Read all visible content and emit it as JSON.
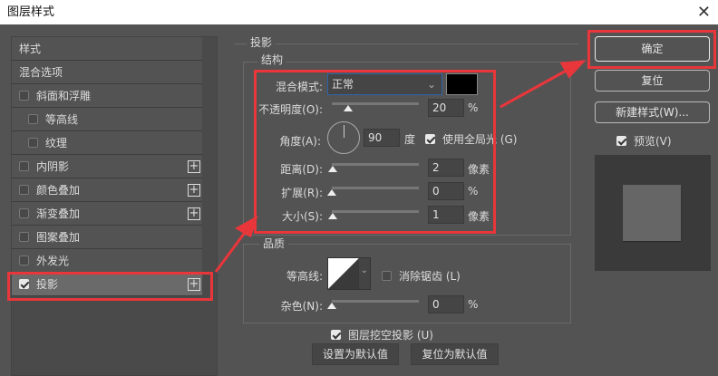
{
  "window": {
    "title": "图层样式",
    "close": "✕"
  },
  "sidebar": {
    "items": [
      {
        "label": "样式"
      },
      {
        "label": "混合选项"
      },
      {
        "label": "斜面和浮雕",
        "checked": false
      },
      {
        "label": "等高线",
        "checked": false
      },
      {
        "label": "纹理",
        "checked": false
      },
      {
        "label": "内阴影",
        "checked": false
      },
      {
        "label": "颜色叠加",
        "checked": false
      },
      {
        "label": "渐变叠加",
        "checked": false
      },
      {
        "label": "图案叠加",
        "checked": false
      },
      {
        "label": "外发光",
        "checked": false
      },
      {
        "label": "投影",
        "checked": true
      }
    ],
    "plus": "+"
  },
  "panel": {
    "title": "投影",
    "structure": {
      "title": "结构",
      "blend_mode_label": "混合模式:",
      "blend_mode": "正常",
      "shadow_color": "#000000",
      "opacity_label": "不透明度(O):",
      "opacity": "20",
      "opacity_unit": "%",
      "angle_label": "角度(A):",
      "angle": "90",
      "angle_unit": "度",
      "global_light_label": "使用全局光 (G)",
      "global_light": true,
      "distance_label": "距离(D):",
      "distance": "2",
      "distance_unit": "像素",
      "spread_label": "扩展(R):",
      "spread": "0",
      "spread_unit": "%",
      "size_label": "大小(S):",
      "size": "1",
      "size_unit": "像素"
    },
    "quality": {
      "title": "品质",
      "contour_label": "等高线:",
      "antialias_label": "消除锯齿 (L)",
      "antialias": false,
      "noise_label": "杂色(N):",
      "noise": "0",
      "noise_unit": "%"
    },
    "knockout_label": "图层挖空投影 (U)",
    "knockout": true,
    "set_default": "设置为默认值",
    "reset_default": "复位为默认值"
  },
  "actions": {
    "ok": "确定",
    "reset": "复位",
    "new_style": "新建样式(W)...",
    "preview_label": "预览(V)",
    "preview": true
  },
  "colors": {
    "highlight": "#e8363b"
  }
}
